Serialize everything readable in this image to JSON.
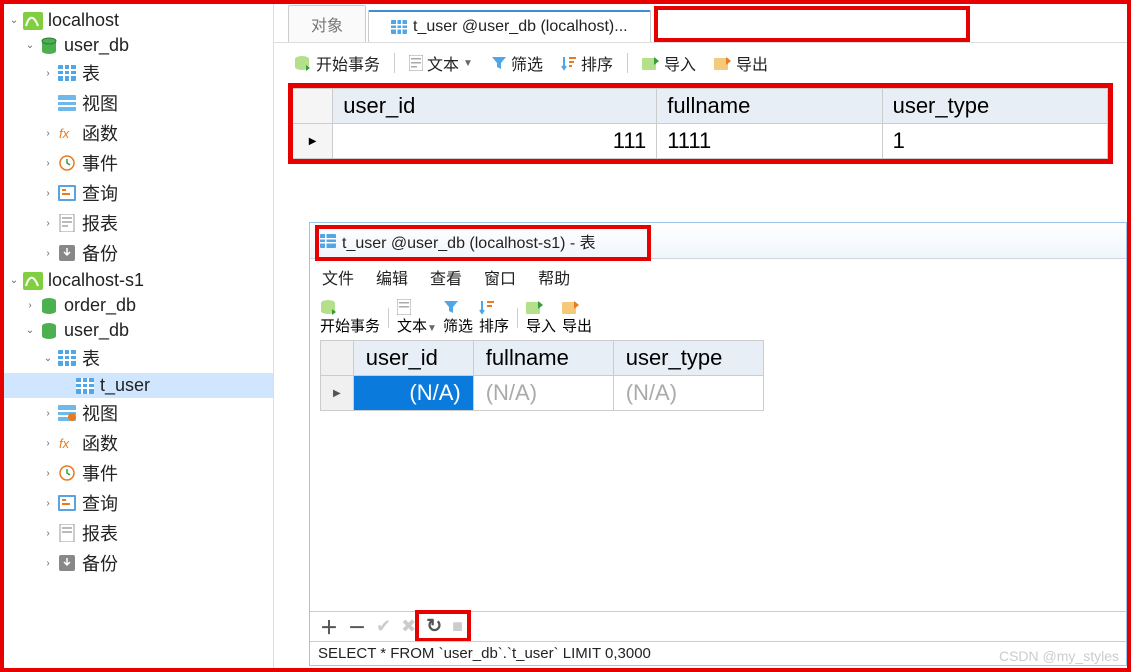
{
  "sidebar": {
    "conn1": "localhost",
    "db1": "user_db",
    "items1": [
      "表",
      "视图",
      "函数",
      "事件",
      "查询",
      "报表",
      "备份"
    ],
    "conn2": "localhost-s1",
    "db2a": "order_db",
    "db2b": "user_db",
    "tables_label": "表",
    "table_name": "t_user",
    "items2": [
      "视图",
      "函数",
      "事件",
      "查询",
      "报表",
      "备份"
    ]
  },
  "topTabs": {
    "objects": "对象",
    "active": "t_user @user_db (localhost)..."
  },
  "toolbar": {
    "begin": "开始事务",
    "text": "文本",
    "filter": "筛选",
    "sort": "排序",
    "imp": "导入",
    "exp": "导出"
  },
  "grid1": {
    "cols": [
      "user_id",
      "fullname",
      "user_type"
    ],
    "row": {
      "user_id": "111",
      "fullname": "1111",
      "user_type": "1"
    }
  },
  "inner": {
    "title": "t_user @user_db (localhost-s1) - 表",
    "menus": [
      "文件",
      "编辑",
      "查看",
      "窗口",
      "帮助"
    ],
    "cols": [
      "user_id",
      "fullname",
      "user_type"
    ],
    "na": "(N/A)",
    "sql": "SELECT * FROM `user_db`.`t_user` LIMIT 0,3000"
  },
  "watermark": "CSDN @my_styles"
}
